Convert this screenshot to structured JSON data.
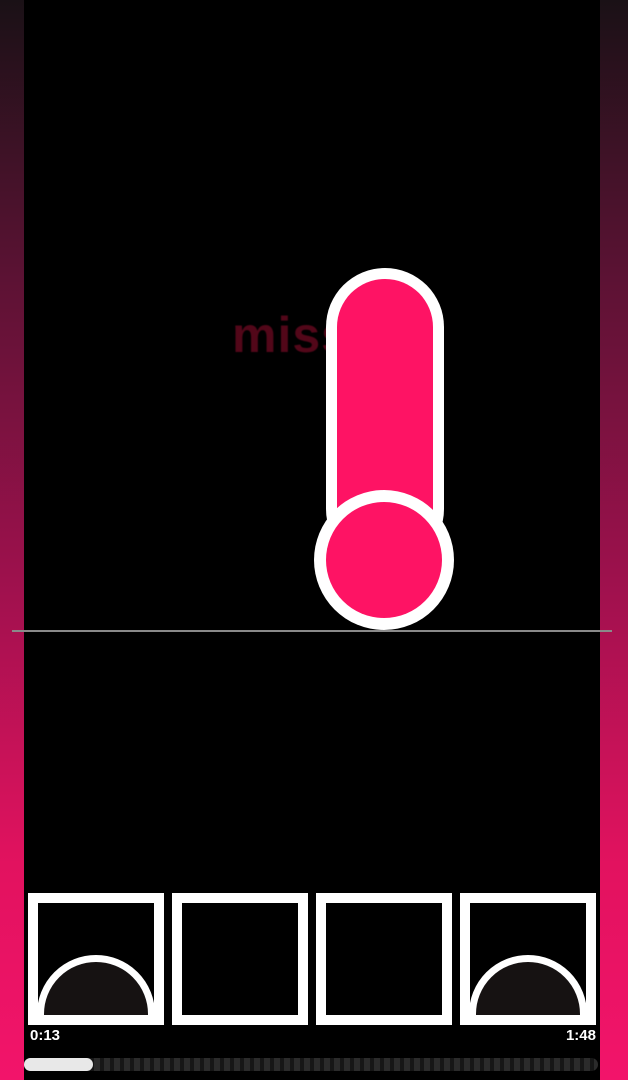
{
  "game": {
    "feedback_text": "miss...",
    "elapsed_time": "0:13",
    "total_time": "1:48",
    "progress_fraction": 0.12,
    "lanes": [
      {
        "lit": true
      },
      {
        "lit": false
      },
      {
        "lit": false
      },
      {
        "lit": true
      }
    ],
    "colors": {
      "note": "#fe1364",
      "note_outline": "#ffffff",
      "accent_gradient_end": "#f2146a"
    }
  }
}
